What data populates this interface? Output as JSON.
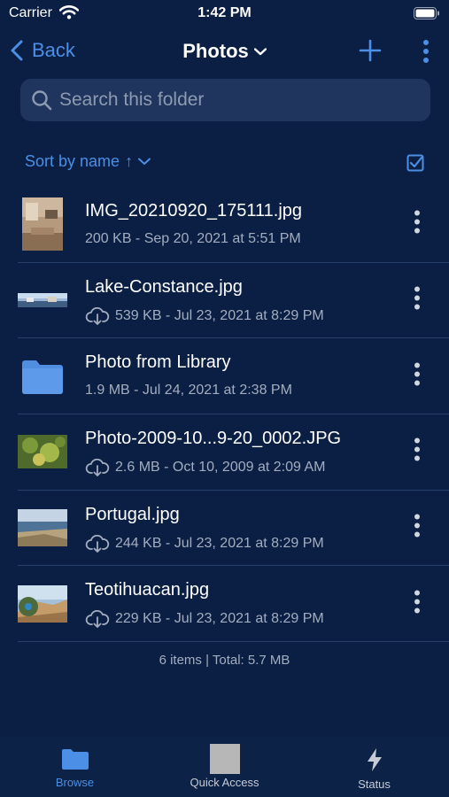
{
  "status_bar": {
    "carrier": "Carrier",
    "time": "1:42 PM"
  },
  "nav": {
    "back_label": "Back",
    "title": "Photos"
  },
  "search": {
    "placeholder": "Search this folder"
  },
  "sort": {
    "label": "Sort by name",
    "direction_symbol": "↑"
  },
  "files": [
    {
      "name": "IMG_20210920_175111.jpg",
      "meta": "200 KB - Sep 20, 2021 at 5:51 PM",
      "cloud": false,
      "thumb": "room-photo"
    },
    {
      "name": "Lake-Constance.jpg",
      "meta": "539 KB - Jul 23, 2021 at 8:29 PM",
      "cloud": true,
      "thumb": "panorama-photo"
    },
    {
      "name": "Photo from Library",
      "meta": "1.9 MB - Jul 24, 2021 at 2:38 PM",
      "cloud": false,
      "thumb": "folder"
    },
    {
      "name": "Photo-2009-10...9-20_0002.JPG",
      "meta": "2.6 MB - Oct 10, 2009 at 2:09 AM",
      "cloud": true,
      "thumb": "foliage-photo"
    },
    {
      "name": "Portugal.jpg",
      "meta": "244 KB - Jul 23, 2021 at 8:29 PM",
      "cloud": true,
      "thumb": "coast-photo"
    },
    {
      "name": "Teotihuacan.jpg",
      "meta": "229 KB - Jul 23, 2021 at 8:29 PM",
      "cloud": true,
      "thumb": "desert-photo"
    }
  ],
  "summary": "6 items | Total: 5.7 MB",
  "tabs": [
    {
      "label": "Browse",
      "icon": "folder-icon",
      "active": true
    },
    {
      "label": "Quick Access",
      "icon": "quick-access-icon",
      "active": false
    },
    {
      "label": "Status",
      "icon": "bolt-icon",
      "active": false
    }
  ],
  "colors": {
    "accent": "#4b8fe6",
    "background": "#0b1f44",
    "secondary_text": "#a3adbf"
  }
}
